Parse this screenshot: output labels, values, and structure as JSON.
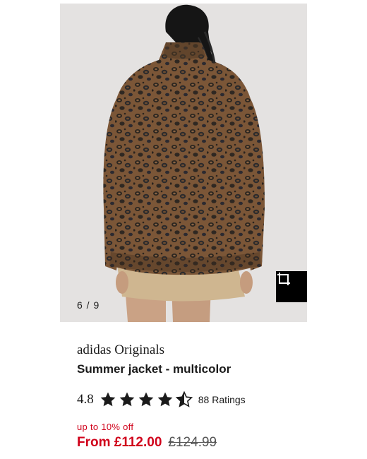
{
  "gallery": {
    "counter": "6 / 9",
    "image_icon": "leopard-jacket-back-view",
    "expand_icon": "expand-crop-icon"
  },
  "product": {
    "brand": "adidas Originals",
    "title": "Summer jacket - multicolor",
    "rating": {
      "value": "4.8",
      "stars_filled": 4.5,
      "stars_total": 5,
      "count_label": "88 Ratings"
    },
    "price": {
      "discount_label": "up to 10% off",
      "current": "From £112.00",
      "original": "£124.99"
    }
  },
  "colors": {
    "sale_red": "#d0021b",
    "text": "#1a1a1a",
    "image_bg": "#e4e2e1"
  }
}
